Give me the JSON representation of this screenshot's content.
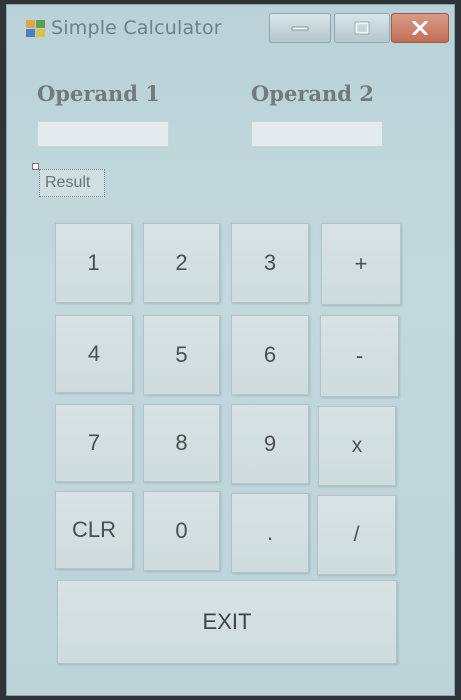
{
  "window": {
    "title": "Simple Calculator",
    "controls": {
      "minimize_icon": "minimize-icon",
      "maximize_icon": "maximize-icon",
      "close_icon": "close-icon"
    }
  },
  "operands": {
    "operand1_label": "Operand 1",
    "operand1_value": "",
    "operand2_label": "Operand 2",
    "operand2_value": ""
  },
  "result_label": "Result",
  "keypad": {
    "row1": [
      "1",
      "2",
      "3",
      "+"
    ],
    "row2": [
      "4",
      "5",
      "6",
      "-"
    ],
    "row3": [
      "7",
      "8",
      "9",
      "x"
    ],
    "row4": [
      "CLR",
      "0",
      ".",
      "/"
    ],
    "exit": "EXIT"
  },
  "colors": {
    "window_bg": "#c3d8dc",
    "close_button": "#c26e57",
    "key_face": "#d6e2e4"
  }
}
